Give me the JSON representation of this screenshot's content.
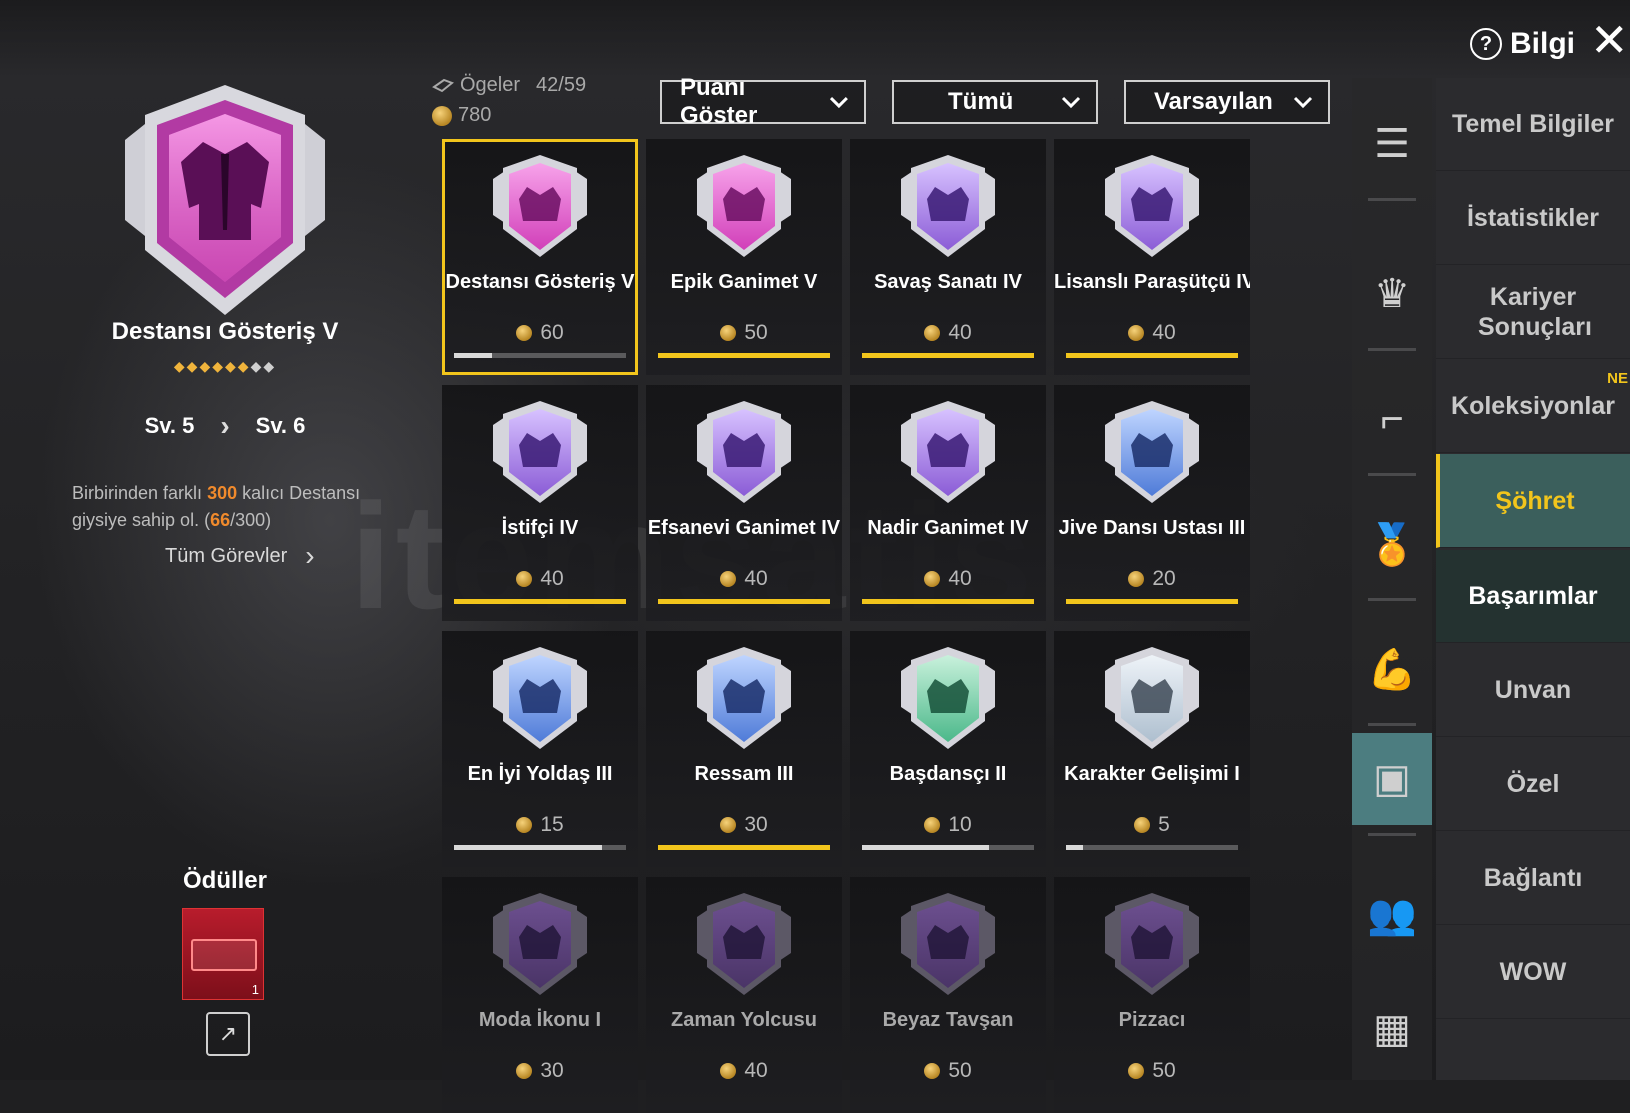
{
  "header": {
    "info_label": "Bilgi",
    "items_label": "Ögeler",
    "items_count": "42/59",
    "points_total": "780",
    "dropdowns": [
      {
        "label": "Puanı Göster"
      },
      {
        "label": "Tümü"
      },
      {
        "label": "Varsayılan"
      }
    ]
  },
  "left": {
    "title": "Destansı Gösteriş V",
    "stars_filled": 6,
    "stars_total": 8,
    "level_current": "Sv. 5",
    "level_next": "Sv. 6",
    "desc_part1": "Birbirinden farklı ",
    "desc_target": "300",
    "desc_part2": " kalıcı Destansı giysiye sahip ol. (",
    "desc_progress": "66",
    "desc_part3": "/300)",
    "all_tasks": "Tüm Görevler",
    "rewards_title": "Ödüller",
    "reward_count": "1"
  },
  "cards": [
    {
      "name": "Destansı Gösteriş V",
      "points": "60",
      "progress": 0.22,
      "icon": "jacket-icon",
      "tier": "epic",
      "bar": "gray"
    },
    {
      "name": "Epik Ganimet V",
      "points": "50",
      "progress": 1.0,
      "icon": "coat-icon",
      "tier": "epic",
      "bar": "yellow"
    },
    {
      "name": "Savaş Sanatı IV",
      "points": "40",
      "progress": 1.0,
      "icon": "claw-icon",
      "tier": "purple",
      "bar": "yellow"
    },
    {
      "name": "Lisanslı Paraşütçü IV",
      "points": "40",
      "progress": 1.0,
      "icon": "parachute-icon",
      "tier": "purple",
      "bar": "yellow"
    },
    {
      "name": "İstifçi IV",
      "points": "40",
      "progress": 1.0,
      "icon": "locker-icon",
      "tier": "purple",
      "bar": "yellow"
    },
    {
      "name": "Efsanevi Ganimet IV",
      "points": "40",
      "progress": 1.0,
      "icon": "coat-icon",
      "tier": "purple",
      "bar": "yellow"
    },
    {
      "name": "Nadir Ganimet IV",
      "points": "40",
      "progress": 1.0,
      "icon": "shirt-icon",
      "tier": "purple",
      "bar": "yellow"
    },
    {
      "name": "Jive Dansı Ustası III",
      "points": "20",
      "progress": 1.0,
      "icon": "dancer-icon",
      "tier": "blue",
      "bar": "yellow"
    },
    {
      "name": "En İyi Yoldaş III",
      "points": "15",
      "progress": 0.86,
      "icon": "eagle-icon",
      "tier": "blue",
      "bar": "gray"
    },
    {
      "name": "Ressam III",
      "points": "30",
      "progress": 1.0,
      "icon": "crosshair-icon",
      "tier": "blue",
      "bar": "yellow"
    },
    {
      "name": "Başdansçı II",
      "points": "10",
      "progress": 0.74,
      "icon": "dancer-icon",
      "tier": "green",
      "bar": "gray"
    },
    {
      "name": "Karakter Gelişimi I",
      "points": "5",
      "progress": 0.1,
      "icon": "figure-icon",
      "tier": "silver",
      "bar": "gray"
    },
    {
      "name": "Moda İkonu I",
      "points": "30",
      "progress": 0.0,
      "icon": "diamond-icon",
      "tier": "locked",
      "bar": "gray"
    },
    {
      "name": "Zaman Yolcusu",
      "points": "40",
      "progress": 0.0,
      "icon": "hexagon-icon",
      "tier": "locked",
      "bar": "gray"
    },
    {
      "name": "Beyaz Tavşan",
      "points": "50",
      "progress": 0.0,
      "icon": "rabbit-icon",
      "tier": "locked",
      "bar": "gray"
    },
    {
      "name": "Pizzacı",
      "points": "50",
      "progress": 0.0,
      "icon": "pizza-icon",
      "tier": "locked",
      "bar": "gray"
    }
  ],
  "menu": [
    {
      "label": "Temel Bilgiler"
    },
    {
      "label": "İstatistikler"
    },
    {
      "label": "Kariyer Sonuçları"
    },
    {
      "label": "Koleksiyonlar",
      "tag": "NE"
    },
    {
      "label": "Şöhret",
      "state": "active"
    },
    {
      "label": "Başarımlar",
      "state": "sub"
    },
    {
      "label": "Unvan"
    },
    {
      "label": "Özel"
    },
    {
      "label": "Bağlantı"
    },
    {
      "label": "WOW"
    }
  ],
  "rail": [
    "list-icon",
    "crown-icon",
    "pistol-icon",
    "medal-icon",
    "muscle-icon",
    "achievement-icon",
    "friends-icon",
    "more-icon"
  ],
  "colors": {
    "accent_yellow": "#f2c51c",
    "active_teal": "#4c7d80",
    "epic_pink": "#d13fb9",
    "purple": "#8b5cd6",
    "blue": "#4f7bd8",
    "green": "#4bb88a",
    "silver": "#aebfcf",
    "locked": "#5a3f7a"
  }
}
